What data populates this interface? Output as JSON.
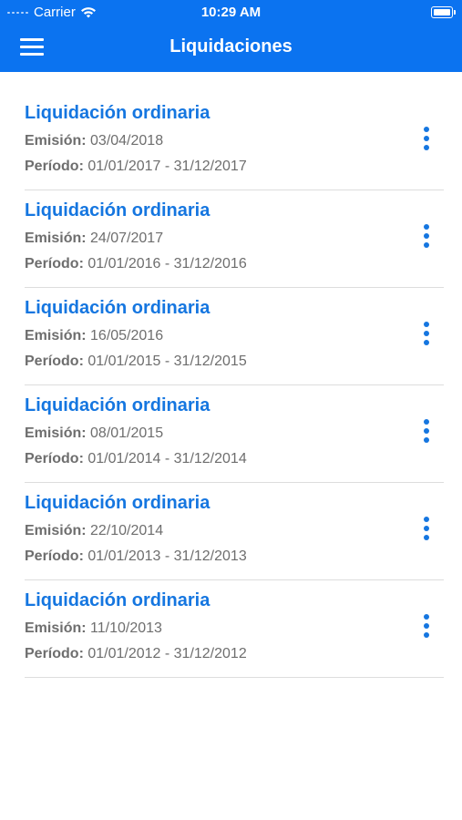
{
  "status_bar": {
    "carrier": "Carrier",
    "time": "10:29 AM"
  },
  "header": {
    "title": "Liquidaciones",
    "menu_icon": "hamburger-icon"
  },
  "list": {
    "emision_label": "Emisión:",
    "periodo_label": "Período:",
    "items": [
      {
        "title": "Liquidación ordinaria",
        "emision": "03/04/2018",
        "periodo": "01/01/2017 - 31/12/2017"
      },
      {
        "title": "Liquidación ordinaria",
        "emision": "24/07/2017",
        "periodo": "01/01/2016 - 31/12/2016"
      },
      {
        "title": "Liquidación ordinaria",
        "emision": "16/05/2016",
        "periodo": "01/01/2015 - 31/12/2015"
      },
      {
        "title": "Liquidación ordinaria",
        "emision": "08/01/2015",
        "periodo": "01/01/2014 - 31/12/2014"
      },
      {
        "title": "Liquidación ordinaria",
        "emision": "22/10/2014",
        "periodo": "01/01/2013 - 31/12/2013"
      },
      {
        "title": "Liquidación ordinaria",
        "emision": "11/10/2013",
        "periodo": "01/01/2012 - 31/12/2012"
      }
    ]
  },
  "colors": {
    "brand": "#0b73f0",
    "accent": "#1576e0",
    "text_secondary": "#6e6e6e"
  }
}
